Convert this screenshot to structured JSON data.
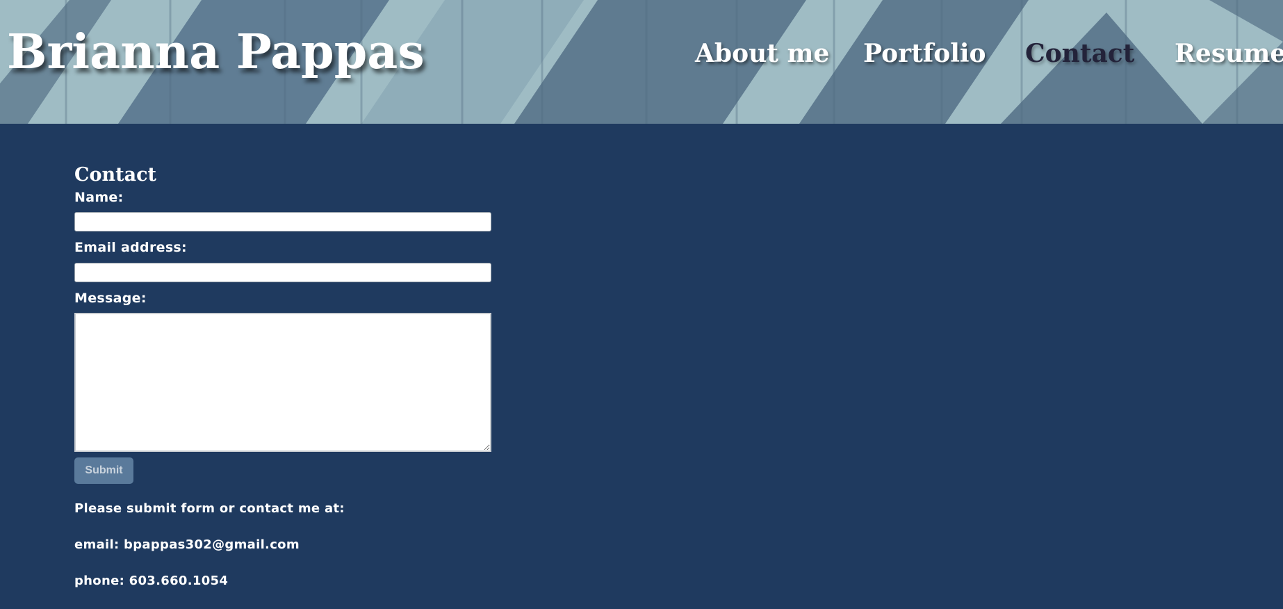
{
  "header": {
    "site_title": "Brianna Pappas",
    "nav": [
      {
        "label": "About me",
        "active": false
      },
      {
        "label": "Portfolio",
        "active": false
      },
      {
        "label": "Contact",
        "active": true
      },
      {
        "label": "Resume",
        "active": false
      }
    ]
  },
  "contact": {
    "title": "Contact",
    "name_label": "Name:",
    "name_value": "",
    "email_label": "Email address:",
    "email_value": "",
    "message_label": "Message:",
    "message_value": "",
    "submit_label": "Submit",
    "info_intro": "Please submit form or contact me at:",
    "email_line": "email: bpappas302@gmail.com",
    "phone_line": "phone: 603.660.1054"
  },
  "colors": {
    "background": "#1f3a5f",
    "header_light": "#9fbcc4",
    "header_dark": "#5f7b90",
    "active_nav": "#23233a",
    "submit_bg": "#5a7a9b"
  }
}
